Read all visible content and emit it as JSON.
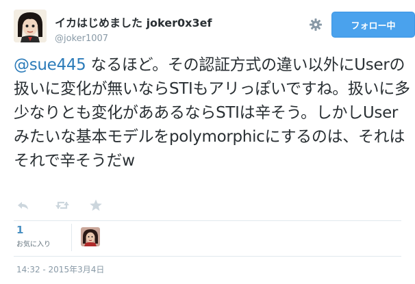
{
  "user": {
    "display_name": "イカはじめました joker0x3ef",
    "screen_name": "@joker1007"
  },
  "header": {
    "follow_label": "フォロー中",
    "settings_icon": "gear-icon"
  },
  "tweet": {
    "mention": "@sue445",
    "text": " なるほど。その認証方式の違い以外にUserの扱いに変化が無いならSTIもアリっぽいですね。扱いに多少なりとも変化がああるならSTIは辛そう。しかしUserみたいな基本モデルをpolymorphicにするのは、それはそれで辛そうだw"
  },
  "actions": {
    "reply_icon": "reply-icon",
    "retweet_icon": "retweet-icon",
    "favorite_icon": "star-icon"
  },
  "stats": {
    "favorites_count": "1",
    "favorites_label": "お気に入り"
  },
  "timestamp": "14:32 - 2015年3月4日",
  "colors": {
    "link": "#2b7bb9",
    "follow_button": "#4aa2ed",
    "muted": "#8899a6",
    "divider": "#e1e8ed"
  }
}
